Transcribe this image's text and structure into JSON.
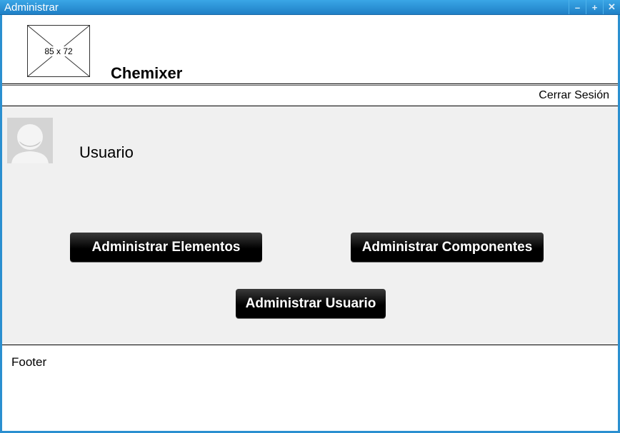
{
  "window": {
    "title": "Administrar",
    "controls": [
      "minimize-icon",
      "maximize-icon",
      "close-icon"
    ],
    "titlebar_color": "#2a8fd0"
  },
  "header": {
    "logo_label": "85 x 72",
    "brand": "Chemixer"
  },
  "nav": {
    "logout": "Cerrar Sesión"
  },
  "user": {
    "name": "Usuario"
  },
  "actions": {
    "manage_elements": "Administrar Elementos",
    "manage_components": "Administrar Componentes",
    "manage_user": "Administrar Usuario"
  },
  "footer": {
    "text": "Footer"
  }
}
